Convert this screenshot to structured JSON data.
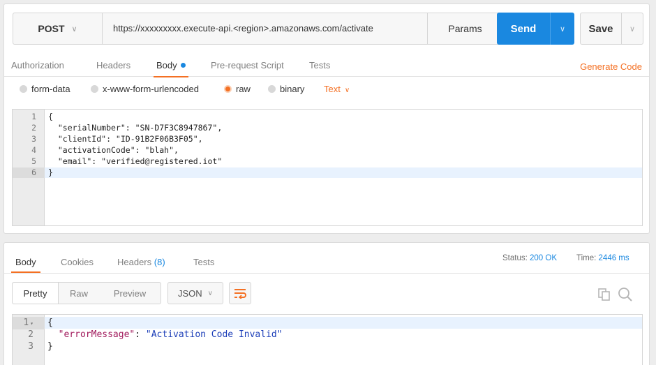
{
  "request": {
    "method": "POST",
    "url": "https://xxxxxxxxx.execute-api.<region>.amazonaws.com/activate",
    "params_label": "Params",
    "send_label": "Send",
    "save_label": "Save",
    "tabs": [
      {
        "label": "Authorization"
      },
      {
        "label": "Headers"
      },
      {
        "label": "Body"
      },
      {
        "label": "Pre-request Script"
      },
      {
        "label": "Tests"
      }
    ],
    "generate_code_label": "Generate Code",
    "body_types": [
      {
        "label": "form-data",
        "selected": false
      },
      {
        "label": "x-www-form-urlencoded",
        "selected": false
      },
      {
        "label": "raw",
        "selected": true
      },
      {
        "label": "binary",
        "selected": false
      }
    ],
    "content_type": "Text",
    "body_lines": [
      {
        "n": "1",
        "text": "{"
      },
      {
        "n": "2",
        "text": "  \"serialNumber\": \"SN-D7F3C8947867\","
      },
      {
        "n": "3",
        "text": "  \"clientId\": \"ID-91B2F06B3F05\","
      },
      {
        "n": "4",
        "text": "  \"activationCode\": \"blah\","
      },
      {
        "n": "5",
        "text": "  \"email\": \"verified@registered.iot\""
      },
      {
        "n": "6",
        "text": "}"
      }
    ]
  },
  "response": {
    "tabs": [
      {
        "label": "Body"
      },
      {
        "label": "Cookies"
      },
      {
        "label": "Headers",
        "count": "(8)"
      },
      {
        "label": "Tests"
      }
    ],
    "status_label": "Status:",
    "status_value": "200 OK",
    "time_label": "Time:",
    "time_value": "2446 ms",
    "views": {
      "pretty": "Pretty",
      "raw": "Raw",
      "preview": "Preview"
    },
    "format": "JSON",
    "body_lines": [
      {
        "n": "1",
        "text": "{"
      },
      {
        "n": "2",
        "key": "\"errorMessage\"",
        "sep": ": ",
        "value": "\"Activation Code Invalid\""
      },
      {
        "n": "3",
        "text": "}"
      }
    ]
  },
  "colors": {
    "accent": "#f47023",
    "primary": "#1a88e0"
  },
  "icons": [
    "chevron-down-icon",
    "wrap-lines-icon",
    "copy-icon",
    "search-icon"
  ]
}
